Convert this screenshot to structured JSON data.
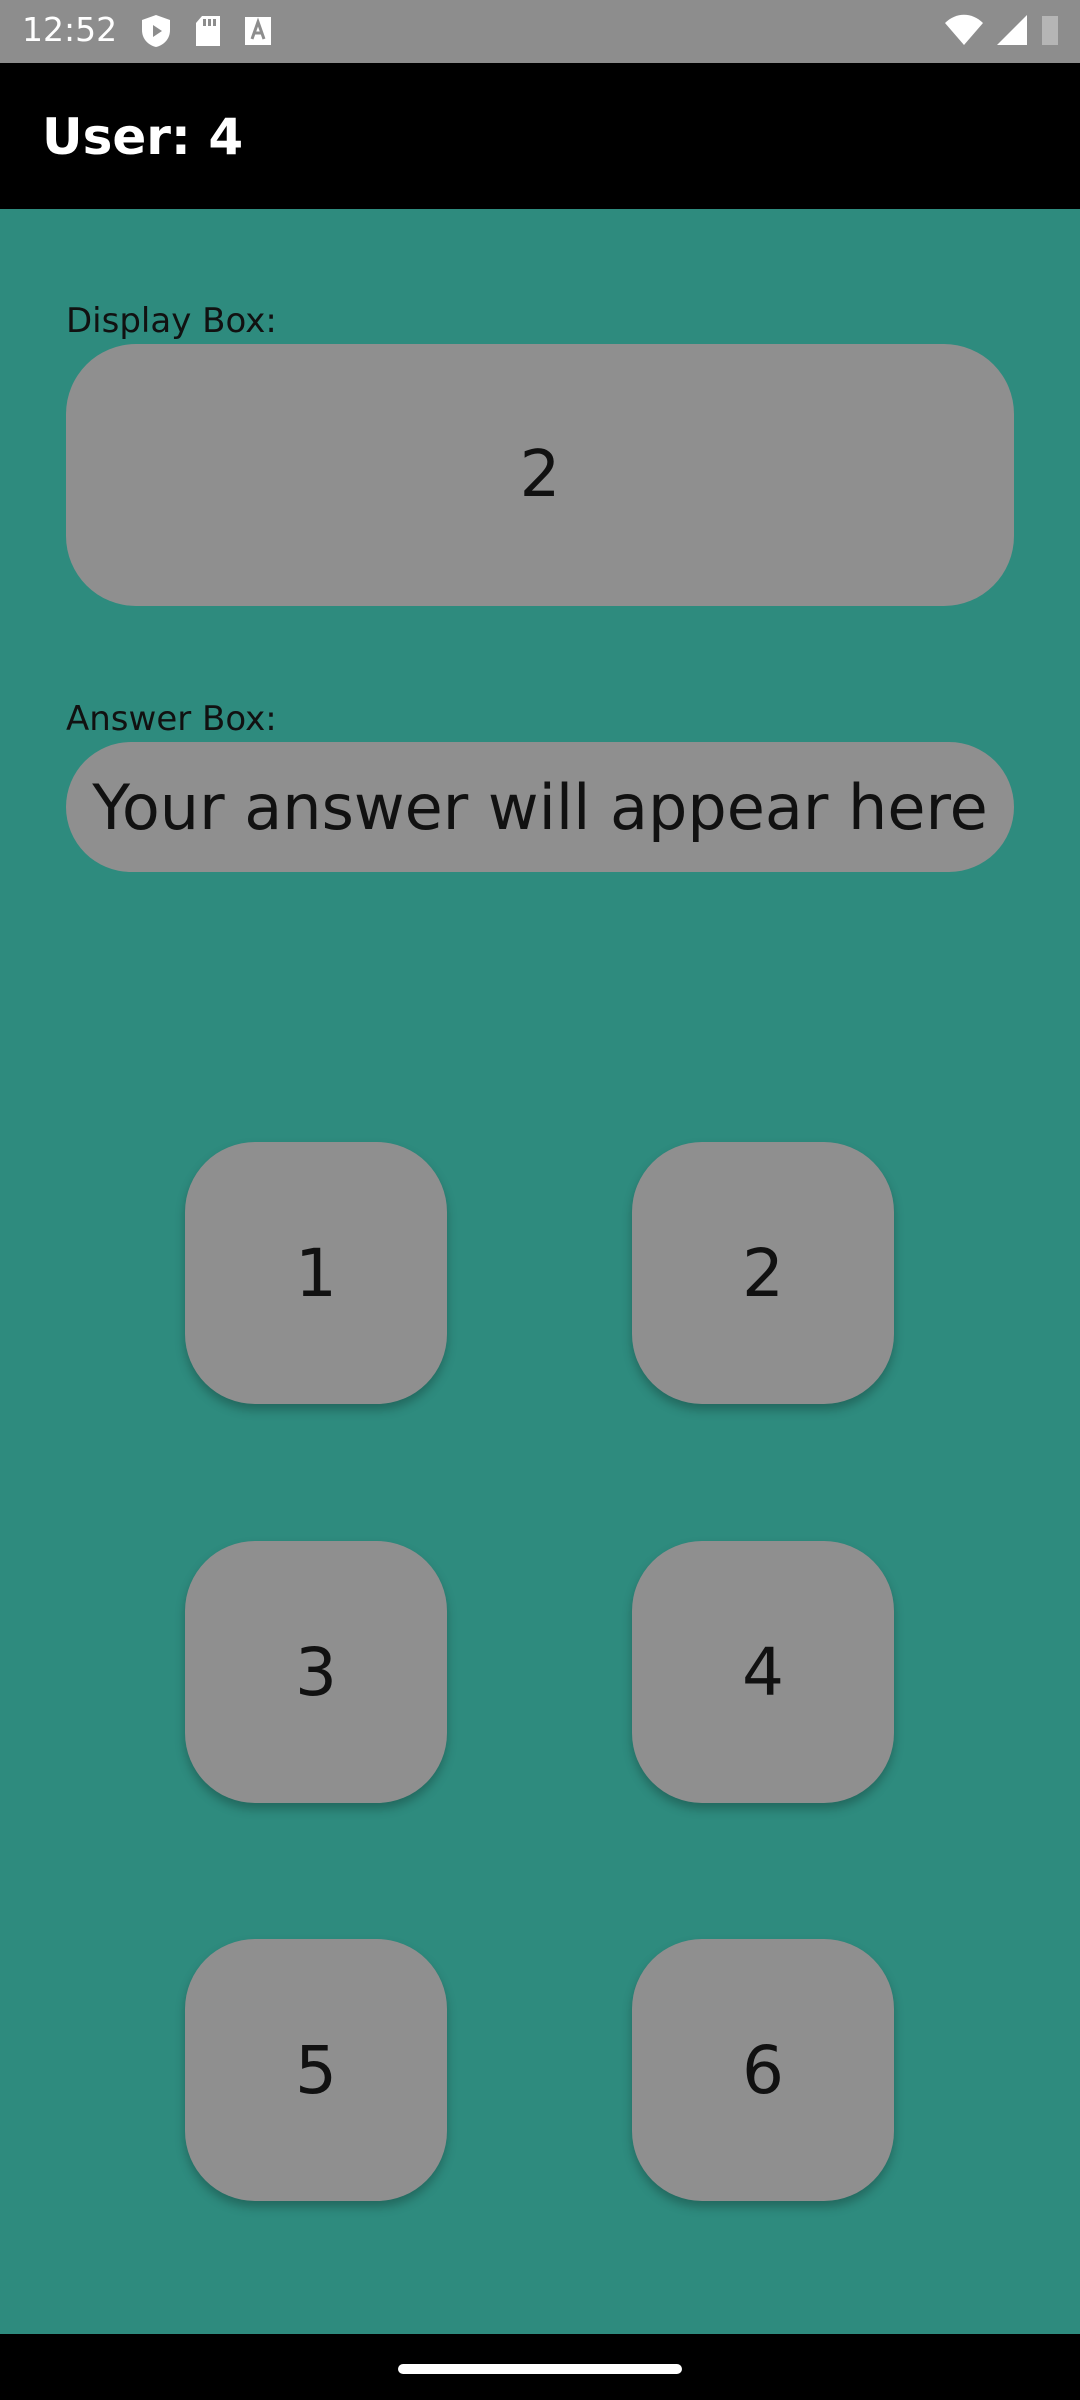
{
  "status_bar": {
    "time": "12:52",
    "left_icons": [
      "shield-play-icon",
      "sd-card-icon",
      "text-a-icon"
    ],
    "right_icons": [
      "wifi-icon",
      "cell-signal-icon",
      "battery-icon"
    ]
  },
  "app_bar": {
    "title": "User: 4"
  },
  "display": {
    "label": "Display Box:",
    "value": "2"
  },
  "answer": {
    "label": "Answer Box:",
    "placeholder": "Your answer will appear here"
  },
  "keypad": {
    "keys": [
      "1",
      "2",
      "3",
      "4",
      "5",
      "6"
    ]
  },
  "colors": {
    "background": "#2e8b7e",
    "box": "#8f8f8f",
    "app_bar": "#000000"
  }
}
